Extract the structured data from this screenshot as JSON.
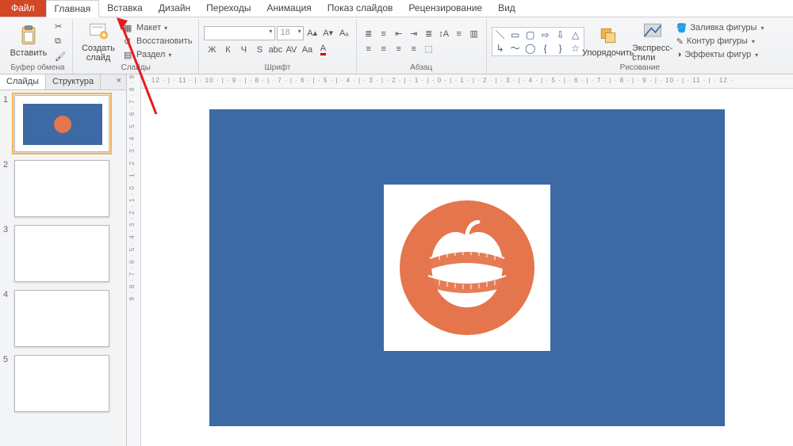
{
  "tabs": {
    "file": "Файл",
    "home": "Главная",
    "insert": "Вставка",
    "design": "Дизайн",
    "transitions": "Переходы",
    "animation": "Анимация",
    "slideshow": "Показ слайдов",
    "review": "Рецензирование",
    "view": "Вид"
  },
  "ribbon": {
    "clipboard": {
      "paste": "Вставить",
      "label": "Буфер обмена"
    },
    "slides": {
      "new_slide": "Создать\nслайд",
      "layout": "Макет",
      "reset": "Восстановить",
      "section": "Раздел",
      "label": "Слайды"
    },
    "font": {
      "size": "18",
      "label": "Шрифт",
      "buttons": [
        "Ж",
        "К",
        "Ч",
        "S",
        "abc",
        "AV"
      ]
    },
    "paragraph": {
      "label": "Абзац"
    },
    "drawing": {
      "arrange": "Упорядочить",
      "quick_styles": "Экспресс-стили",
      "shape_fill": "Заливка фигуры",
      "shape_outline": "Контур фигуры",
      "shape_effects": "Эффекты фигур",
      "label": "Рисование"
    }
  },
  "sidepanel": {
    "tab_slides": "Слайды",
    "tab_outline": "Структура",
    "close": "×",
    "slide_numbers": [
      "1",
      "2",
      "3",
      "4",
      "5"
    ]
  },
  "ruler": {
    "h": "· 12 · | · 11 · | · 10 · | · 9 · | · 8 · | · 7 · | · 6 · | · 5 · | · 4 · | · 3 · | · 2 · | · 1 · | · 0 · | · 1 · | · 2 · | · 3 · | · 4 · | · 5 · | · 6 · | · 7 · | · 8 · | · 9 · | · 10 · | · 11 · | · 12 ·",
    "v": "9 · 8 · 7 · 6 · 5 · 4 · 3 · 2 · 1 · 0 · 1 · 2 · 3 · 4 · 5 · 6 · 7 · 8 · 9"
  },
  "colors": {
    "accent": "#d24726",
    "slide_bg": "#3d6aa5",
    "logo": "#e5754c"
  }
}
